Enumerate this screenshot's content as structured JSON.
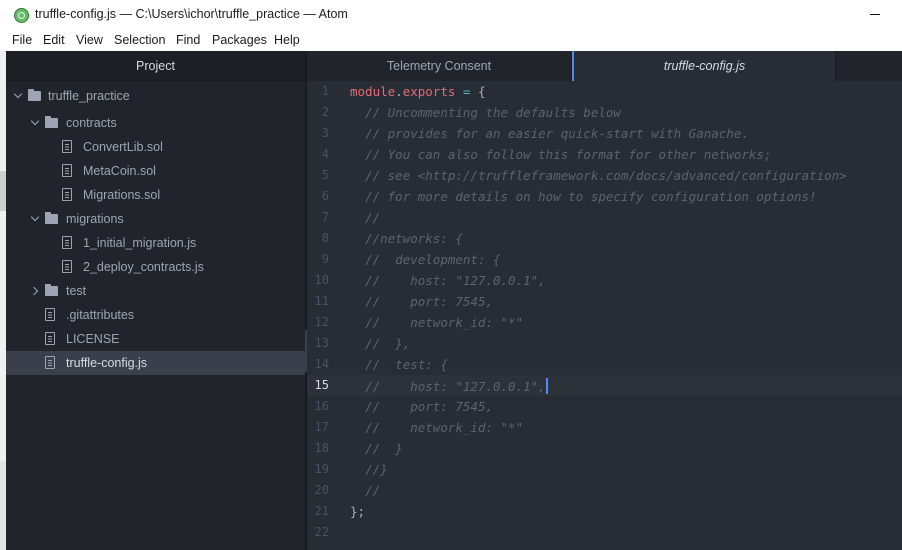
{
  "window": {
    "title": "truffle-config.js — C:\\Users\\ichor\\truffle_practice — Atom"
  },
  "menu": [
    "File",
    "Edit",
    "View",
    "Selection",
    "Find",
    "Packages",
    "Help"
  ],
  "tree_view": {
    "title": "Project",
    "items": [
      {
        "label": "truffle_practice",
        "type": "folder",
        "expanded": true
      },
      {
        "label": "contracts",
        "type": "folder",
        "expanded": true
      },
      {
        "label": "ConvertLib.sol",
        "type": "file"
      },
      {
        "label": "MetaCoin.sol",
        "type": "file"
      },
      {
        "label": "Migrations.sol",
        "type": "file"
      },
      {
        "label": "migrations",
        "type": "folder",
        "expanded": true
      },
      {
        "label": "1_initial_migration.js",
        "type": "file"
      },
      {
        "label": "2_deploy_contracts.js",
        "type": "file"
      },
      {
        "label": "test",
        "type": "folder",
        "expanded": false
      },
      {
        "label": ".gitattributes",
        "type": "file"
      },
      {
        "label": "LICENSE",
        "type": "file"
      },
      {
        "label": "truffle-config.js",
        "type": "file",
        "selected": true
      }
    ]
  },
  "tabs": [
    {
      "label": "Telemetry Consent",
      "active": false
    },
    {
      "label": "truffle-config.js",
      "active": true
    }
  ],
  "editor": {
    "cursor_line": 15,
    "lines": [
      {
        "num": "1",
        "text": "module.exports = {"
      },
      {
        "num": "2",
        "text": "  // Uncommenting the defaults below"
      },
      {
        "num": "3",
        "text": "  // provides for an easier quick-start with Ganache."
      },
      {
        "num": "4",
        "text": "  // You can also follow this format for other networks;"
      },
      {
        "num": "5",
        "text": "  // see <http://truffleframework.com/docs/advanced/configuration>"
      },
      {
        "num": "6",
        "text": "  // for more details on how to specify configuration options!"
      },
      {
        "num": "7",
        "text": "  //"
      },
      {
        "num": "8",
        "text": "  //networks: {"
      },
      {
        "num": "9",
        "text": "  //  development: {"
      },
      {
        "num": "10",
        "text": "  //    host: \"127.0.0.1\","
      },
      {
        "num": "11",
        "text": "  //    port: 7545,"
      },
      {
        "num": "12",
        "text": "  //    network_id: \"*\""
      },
      {
        "num": "13",
        "text": "  //  },"
      },
      {
        "num": "14",
        "text": "  //  test: {"
      },
      {
        "num": "15",
        "text": "  //    host: \"127.0.0.1\","
      },
      {
        "num": "16",
        "text": "  //    port: 7545,"
      },
      {
        "num": "17",
        "text": "  //    network_id: \"*\""
      },
      {
        "num": "18",
        "text": "  //  }"
      },
      {
        "num": "19",
        "text": "  //}"
      },
      {
        "num": "20",
        "text": "  //"
      },
      {
        "num": "21",
        "text": "};"
      },
      {
        "num": "22",
        "text": ""
      }
    ]
  },
  "colors": {
    "editor_bg": "#282c34",
    "panel_bg": "#21252b",
    "comment": "#5c6370",
    "keyword_var": "#e06c75",
    "operator": "#56b6c2",
    "cursor": "#528bff",
    "tab_accent": "#568af2"
  }
}
